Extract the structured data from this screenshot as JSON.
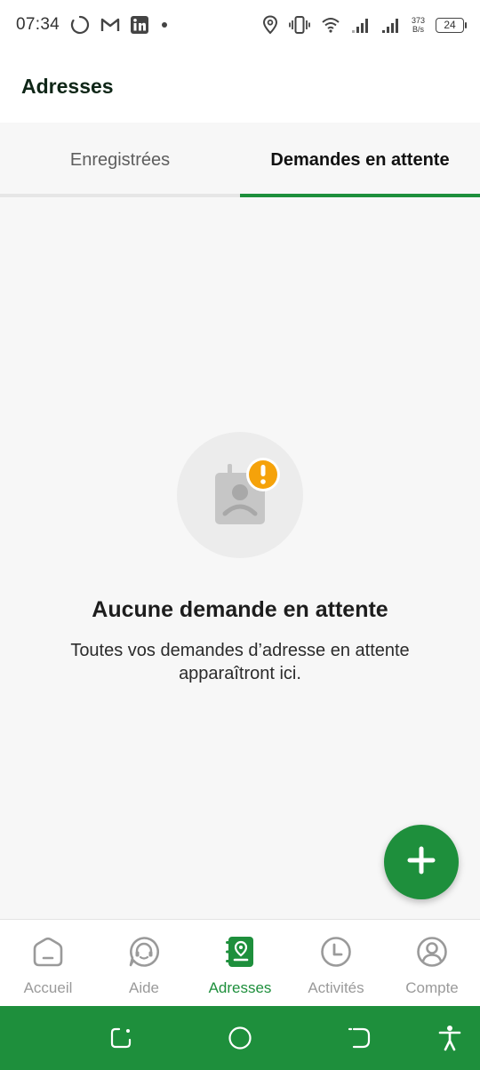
{
  "status_bar": {
    "time": "07:34",
    "speed_value": "373",
    "speed_unit": "B/s",
    "battery": "24",
    "icons": [
      "loading-icon",
      "gmail-icon",
      "linkedin-icon",
      "dot-icon",
      "location-icon",
      "vibrate-icon",
      "wifi-icon",
      "signal-icon",
      "signal-icon-2"
    ]
  },
  "app_bar": {
    "title": "Adresses"
  },
  "tabs": [
    {
      "label": "Enregistrées",
      "active": false
    },
    {
      "label": "Demandes en attente",
      "active": true
    }
  ],
  "empty_state": {
    "icon": "sad-contact-warning-icon",
    "title": "Aucune demande en attente",
    "description": "Toutes vos demandes d’adresse en attente apparaîtront ici."
  },
  "fab": {
    "icon": "plus-icon"
  },
  "bottom_nav": {
    "items": [
      {
        "label": "Accueil",
        "icon": "home-icon",
        "active": false
      },
      {
        "label": "Aide",
        "icon": "help-chat-icon",
        "active": false
      },
      {
        "label": "Adresses",
        "icon": "address-book-icon",
        "active": true
      },
      {
        "label": "Activités",
        "icon": "clock-icon",
        "active": false
      },
      {
        "label": "Compte",
        "icon": "account-icon",
        "active": false
      }
    ]
  },
  "system_nav": {
    "icons": [
      "recents-icon",
      "home-circle-icon",
      "back-icon",
      "accessibility-icon"
    ]
  },
  "colors": {
    "accent": "#1e8f3c",
    "warning": "#f5a20a",
    "background": "#f7f7f7",
    "inactive": "#9a9a9a"
  }
}
